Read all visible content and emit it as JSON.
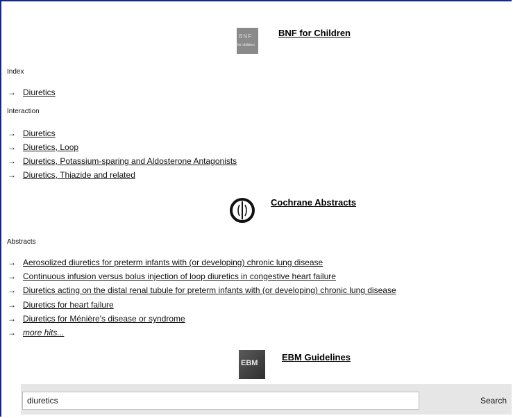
{
  "colors": {
    "frame_border": "#1a2a6c",
    "search_bar_bg": "#e6e6e6"
  },
  "sections": [
    {
      "title": "BNF for Children",
      "logo_icon": "bnf-for-children-logo",
      "logo_text_top": "BNF",
      "logo_text_bottom": "for children",
      "groups": [
        {
          "category": "Index",
          "items": [
            "Diuretics"
          ]
        },
        {
          "category": "Interaction",
          "items": [
            "Diuretics",
            "Diuretics, Loop",
            "Diuretics, Potassium-sparing and Aldosterone Antagonists",
            "Diuretics, Thiazide and related"
          ]
        }
      ]
    },
    {
      "title": "Cochrane Abstracts",
      "logo_icon": "cochrane-logo",
      "groups": [
        {
          "category": "Abstracts",
          "items": [
            "Aerosolized diuretics for preterm infants with (or developing) chronic lung disease",
            "Continuous infusion versus bolus injection of loop diuretics in congestive heart failure",
            "Diuretics acting on the distal renal tubule for preterm infants with (or developing) chronic lung disease",
            "Diuretics for heart failure",
            "Diuretics for Ménière's disease or syndrome"
          ],
          "more": "more hits..."
        }
      ]
    },
    {
      "title": "EBM Guidelines",
      "logo_icon": "ebm-guidelines-logo",
      "logo_text": "EBM"
    }
  ],
  "arrow_glyph": "→",
  "search": {
    "value": "diuretics",
    "button_label": "Search"
  }
}
